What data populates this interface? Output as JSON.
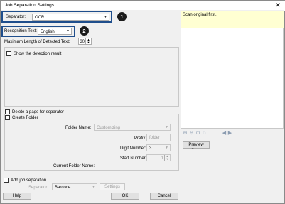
{
  "window": {
    "title": "Job Separation Settings",
    "close_glyph": "✕"
  },
  "separator": {
    "label": "Separator:",
    "value": "OCR"
  },
  "recognition": {
    "label": "Recognition Text:",
    "value": "English"
  },
  "max_length": {
    "label": "Maximum Length of Detected Text:",
    "value": "30"
  },
  "show_detection": {
    "label": "Show the detection result",
    "checked": false
  },
  "delete_page": {
    "label": "Delete a page for separator",
    "checked": false
  },
  "create_folder": {
    "label": "Create Folder",
    "checked": false,
    "folder_name_label": "Folder Name:",
    "folder_name_value": "Customizing",
    "prefix_label": "Prefix:",
    "prefix_value": "folder",
    "digit_label": "Digit Number:",
    "digit_value": "3",
    "start_label": "Start Number:",
    "start_value": "1",
    "current_label": "Current Folder Name:"
  },
  "add_job": {
    "label": "Add job separation",
    "checked": false,
    "separator_label": "Separator:",
    "separator_value": "Barcode",
    "settings_label": "Settings"
  },
  "buttons": {
    "help": "Help",
    "ok": "OK",
    "cancel": "Cancel"
  },
  "preview": {
    "message": "Scan original first.",
    "scan_button": "Preview Scan"
  },
  "callouts": [
    "1",
    "2"
  ],
  "colors": {
    "highlight": "#1f4e8c",
    "message_bg": "#ffffd2"
  }
}
